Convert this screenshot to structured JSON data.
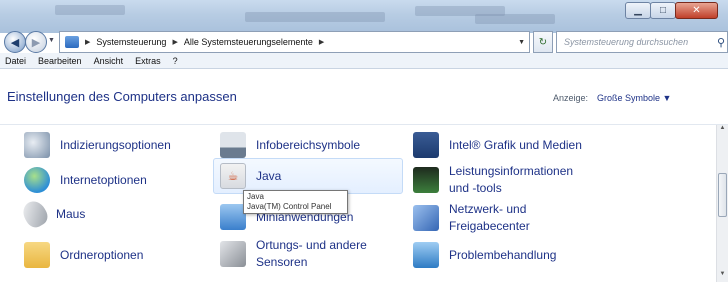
{
  "window": {
    "minimize_icon": "minimize-icon",
    "maximize_icon": "maximize-icon",
    "close_icon": "close-icon"
  },
  "nav": {
    "back_icon": "back-arrow-icon",
    "forward_icon": "forward-arrow-icon",
    "breadcrumb": [
      "Systemsteuerung",
      "Alle Systemsteuerungselemente"
    ],
    "search_placeholder": "Systemsteuerung durchsuchen"
  },
  "menubar": {
    "items": [
      "Datei",
      "Bearbeiten",
      "Ansicht",
      "Extras",
      "?"
    ]
  },
  "header": {
    "title": "Einstellungen des Computers anpassen",
    "view_label": "Anzeige:",
    "view_value": "Große Symbole ▼"
  },
  "items": {
    "col1": [
      {
        "label": "Indizierungsoptionen",
        "icon": "indexing-options-icon",
        "color": "#7a8fa8"
      },
      {
        "label": "Internetoptionen",
        "icon": "internet-options-icon",
        "color": "#2e8fd6"
      },
      {
        "label": "Maus",
        "icon": "mouse-icon",
        "color": "#9aa0a8"
      },
      {
        "label": "Ordneroptionen",
        "icon": "folder-options-icon",
        "color": "#e9b640"
      }
    ],
    "col2": [
      {
        "label": "Infobereichsymbole",
        "icon": "notification-area-icon",
        "color": "#6a7b8f"
      },
      {
        "label": "Java",
        "icon": "java-icon",
        "color": "#d0542b"
      },
      {
        "label": "Minianwendungen",
        "icon": "gadgets-icon",
        "color": "#3a7fcc"
      },
      {
        "label": "Ortungs- und andere Sensoren",
        "icon": "location-sensors-icon",
        "color": "#8a8f96"
      }
    ],
    "col3": [
      {
        "label": "Intel® Grafik und Medien",
        "icon": "intel-graphics-icon",
        "color": "#1c3a6e"
      },
      {
        "label": "Leistungsinformationen und -tools",
        "icon": "performance-icon",
        "color": "#3c7f3c"
      },
      {
        "label": "Netzwerk- und Freigabecenter",
        "icon": "network-sharing-icon",
        "color": "#3566b4"
      },
      {
        "label": "Problembehandlung",
        "icon": "troubleshooting-icon",
        "color": "#2e7bc4"
      }
    ]
  },
  "tooltip": {
    "line1": "Java",
    "line2": "Java(TM) Control Panel"
  }
}
